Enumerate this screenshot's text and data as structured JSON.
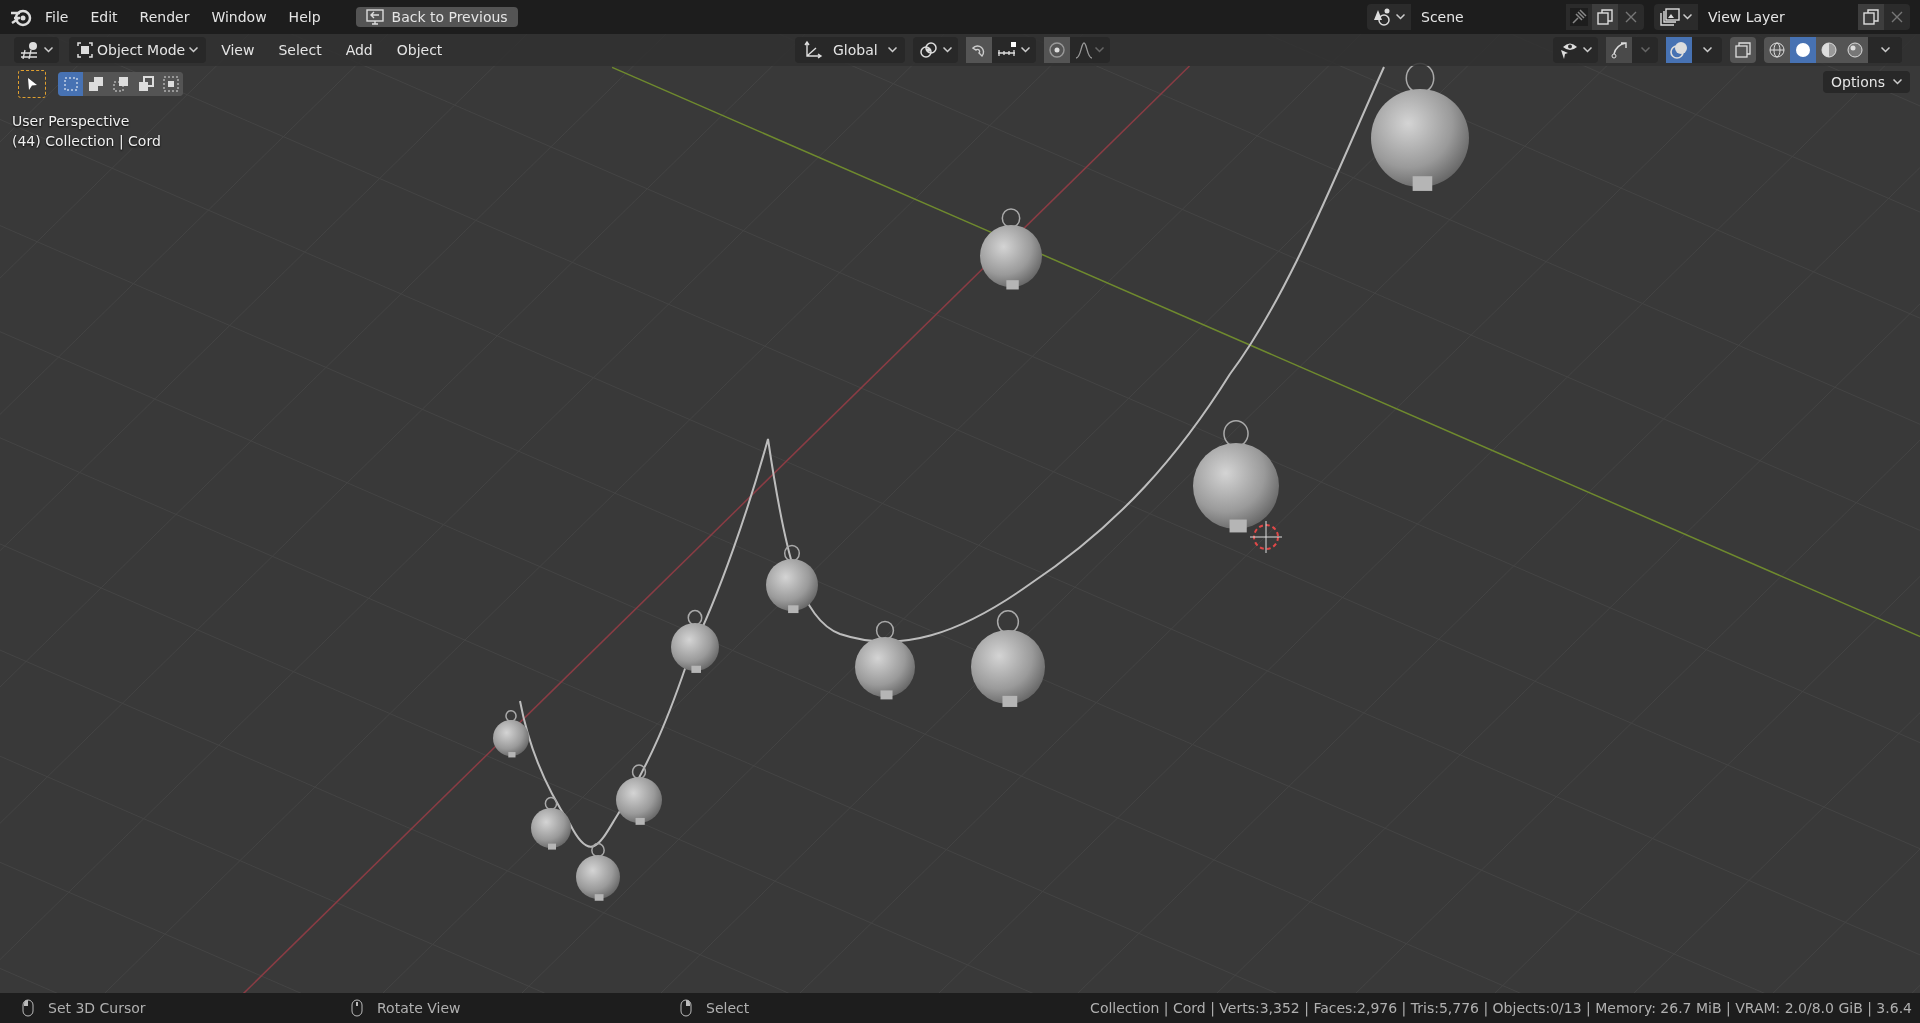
{
  "topbar": {
    "menus": [
      "File",
      "Edit",
      "Render",
      "Window",
      "Help"
    ],
    "back_button": "Back to Previous",
    "scene": {
      "name": "Scene"
    },
    "view_layer": {
      "name": "View Layer"
    }
  },
  "header": {
    "mode": "Object Mode",
    "menus": [
      "View",
      "Select",
      "Add",
      "Object"
    ],
    "orientation": "Global",
    "overlays": {
      "on": true
    },
    "shading": [
      {
        "kind": "wireframe",
        "selected": false
      },
      {
        "kind": "solid",
        "selected": true
      },
      {
        "kind": "material",
        "selected": false
      },
      {
        "kind": "rendered",
        "selected": false
      }
    ]
  },
  "toolbar": {
    "select_modes": [
      {
        "kind": "set",
        "selected": true
      },
      {
        "kind": "extend",
        "selected": false
      },
      {
        "kind": "subtract",
        "selected": false
      },
      {
        "kind": "invert",
        "selected": false
      },
      {
        "kind": "intersect",
        "selected": false
      }
    ],
    "options": "Options"
  },
  "viewport": {
    "view_name": "User Perspective",
    "object_info": "(44) Collection | Cord"
  },
  "status_bar": {
    "hints": [
      {
        "kind": "left",
        "label": "Set 3D Cursor"
      },
      {
        "kind": "middle",
        "label": "Rotate View"
      },
      {
        "kind": "right",
        "label": "Select"
      }
    ],
    "stats": "Collection | Cord | Verts:3,352 | Faces:2,976 | Tris:5,776 | Objects:0/13 | Memory: 26.7 MiB | VRAM: 2.0/8.0 GiB | 3.6.4"
  }
}
